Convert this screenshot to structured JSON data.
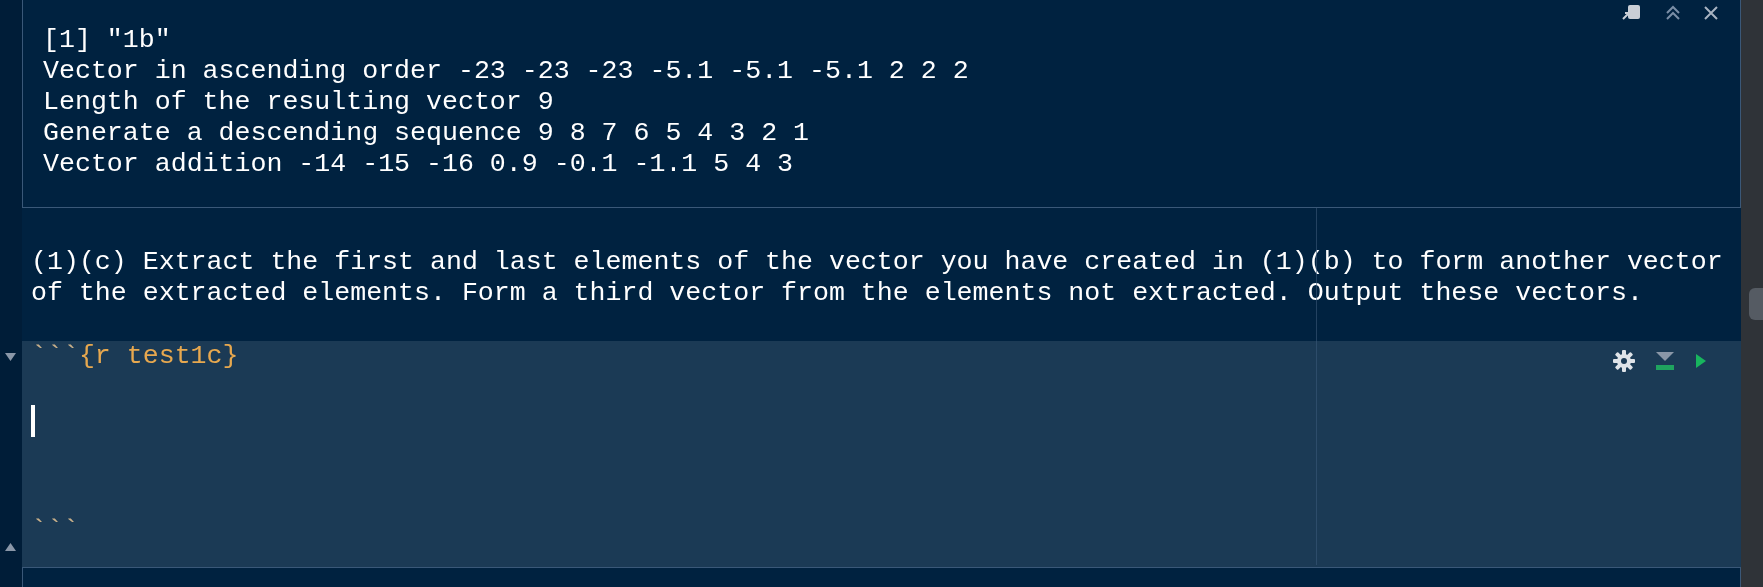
{
  "output_panel": {
    "lines": [
      "[1] \"1b\"",
      "Vector in ascending order -23 -23 -23 -5.1 -5.1 -5.1 2 2 2",
      "Length of the resulting vector 9",
      "Generate a descending sequence 9 8 7 6 5 4 3 2 1",
      "Vector addition -14 -15 -16 0.9 -0.1 -1.1 5 4 3"
    ]
  },
  "prose": {
    "lines": [
      "(1)(c) Extract the first and last elements of the vector you have created in (1)(b) to form another vector",
      "of the extracted elements. Form a third vector from the elements not extracted. Output these vectors."
    ]
  },
  "chunk": {
    "fence": "```",
    "label": "{r test1c}",
    "cursor": true,
    "end_fence": "```"
  }
}
